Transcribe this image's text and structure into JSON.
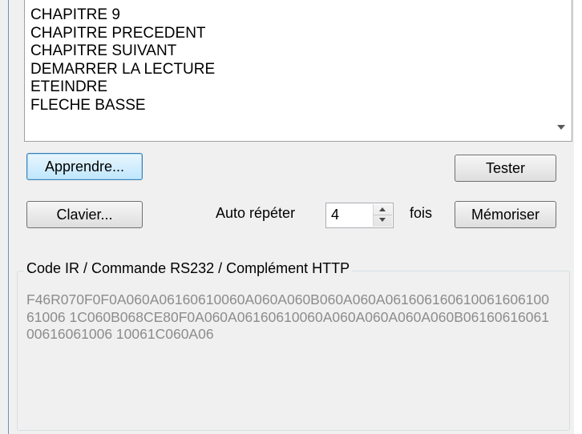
{
  "list": {
    "items": [
      "CHAPITRE 9",
      "CHAPITRE PRECEDENT",
      "CHAPITRE SUIVANT",
      "DEMARRER LA LECTURE",
      "ETEINDRE",
      "FLECHE BASSE"
    ]
  },
  "buttons": {
    "apprendre": "Apprendre...",
    "tester": "Tester",
    "clavier": "Clavier...",
    "memoriser": "Mémoriser"
  },
  "repeat": {
    "label": "Auto répéter",
    "value": "4",
    "unit": "fois"
  },
  "code_group": {
    "title": "Code IR / Commande RS232 / Complément HTTP",
    "value": "F46R070F0F0A060A06160610060A060A060B060A060A06160616061006160610061006 1C060B068CE80F0A060A06160610060A060A060A060A060B0616061606100616061006 10061C060A06"
  },
  "colors": {
    "accent_border": "#3c7fb1",
    "code_text": "#8c8c8c",
    "panel_bg": "#f0f0f0"
  }
}
